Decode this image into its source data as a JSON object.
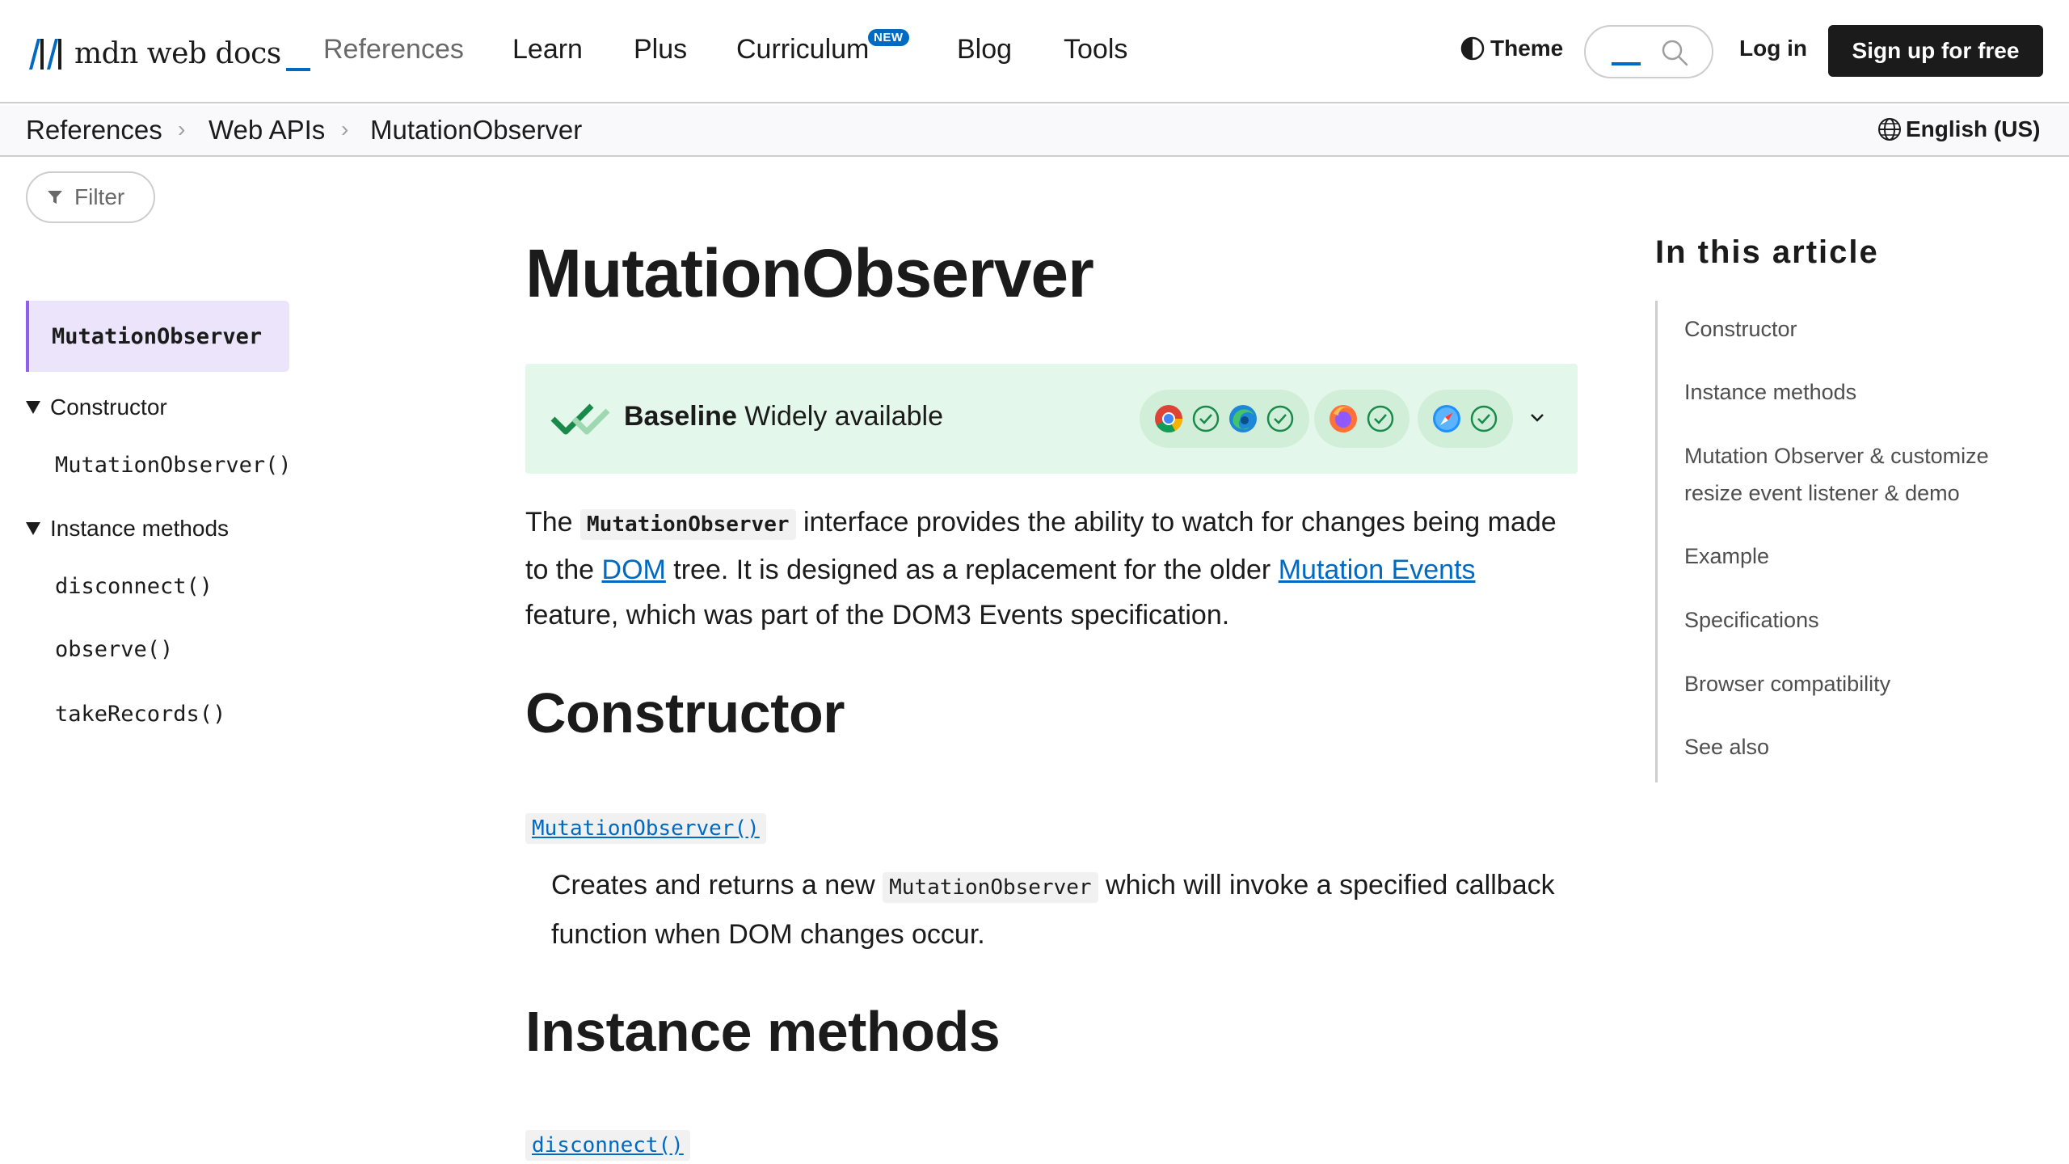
{
  "header": {
    "logo_text": "mdn web docs",
    "nav": [
      {
        "label": "References"
      },
      {
        "label": "Learn"
      },
      {
        "label": "Plus"
      },
      {
        "label": "Curriculum"
      },
      {
        "label": "Blog"
      },
      {
        "label": "Tools"
      }
    ],
    "curriculum_badge": "NEW",
    "theme_label": "Theme",
    "login_label": "Log in",
    "signup_label": "Sign up for free"
  },
  "breadcrumb": {
    "items": [
      "References",
      "Web APIs",
      "MutationObserver"
    ],
    "separator": "›",
    "language": "English (US)"
  },
  "sidebar": {
    "filter_placeholder": "Filter",
    "active": "MutationObserver",
    "groups": [
      {
        "label": "Constructor",
        "items": [
          "MutationObserver()"
        ]
      },
      {
        "label": "Instance methods",
        "items": [
          "disconnect()",
          "observe()",
          "takeRecords()"
        ]
      }
    ]
  },
  "article": {
    "title": "MutationObserver",
    "baseline": {
      "bold": "Baseline",
      "text": " Widely available"
    },
    "browser_icons": [
      "chrome-icon",
      "edge-icon",
      "firefox-icon",
      "safari-icon"
    ],
    "intro": {
      "p1": "The ",
      "code1": "MutationObserver",
      "p2": " interface provides the ability to watch for changes being made to the ",
      "link1": "DOM",
      "p3": " tree. It is designed as a replacement for the older ",
      "link2": "Mutation Events",
      "p4": " feature, which was part of the DOM3 Events specification."
    },
    "constructor_heading": "Constructor",
    "constructor_link": "MutationObserver()",
    "constructor_desc": {
      "p1": "Creates and returns a new ",
      "code": "MutationObserver",
      "p2": " which will invoke a specified callback function when DOM changes occur."
    },
    "methods_heading": "Instance methods",
    "methods_link": "disconnect()"
  },
  "toc": {
    "title": "In this article",
    "items": [
      "Constructor",
      "Instance methods",
      "Mutation Observer & customize resize event listener & demo",
      "Example",
      "Specifications",
      "Browser compatibility",
      "See also"
    ]
  },
  "colors": {
    "accent": "#0069c2",
    "active_border": "#8f5ff0",
    "active_bg": "#ece4fb",
    "baseline_bg": "#e4f7eb",
    "signup_bg": "#1b1b1b"
  }
}
